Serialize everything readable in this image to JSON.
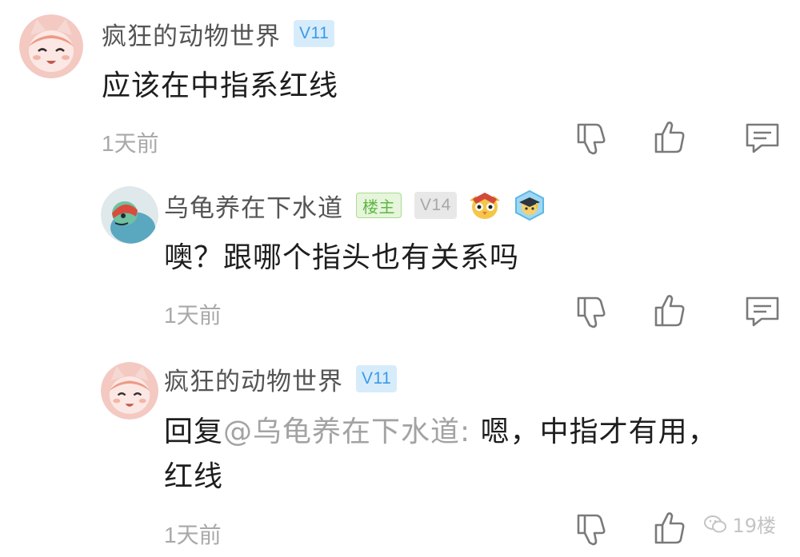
{
  "comments": [
    {
      "username": "疯狂的动物世界",
      "level": "V11",
      "content": "应该在中指系红线",
      "time": "1天前"
    },
    {
      "username": "乌龟养在下水道",
      "op_badge": "楼主",
      "level": "V14",
      "medals": [
        "owl-medal-icon",
        "graduate-medal-icon"
      ],
      "content": "噢？跟哪个指头也有关系吗",
      "time": "1天前"
    },
    {
      "username": "疯狂的动物世界",
      "level": "V11",
      "reply_prefix": "回复",
      "mention": "@乌龟养在下水道:",
      "content_line1": " 嗯，中指才有用，",
      "content_line2": "红线",
      "time": "1天前"
    }
  ],
  "actions": {
    "dislike_icon": "thumbs-down-icon",
    "like_icon": "thumbs-up-icon",
    "reply_icon": "comment-icon"
  },
  "watermark": {
    "text": "19楼",
    "icon": "wechat-icon"
  },
  "colors": {
    "level_badge_blue": "#3b9ae6",
    "level_badge_grey": "#a8a8a8",
    "op_badge_green": "#5fb742",
    "time_text": "#a9a9a9",
    "mention_text": "#a3a3a3"
  }
}
